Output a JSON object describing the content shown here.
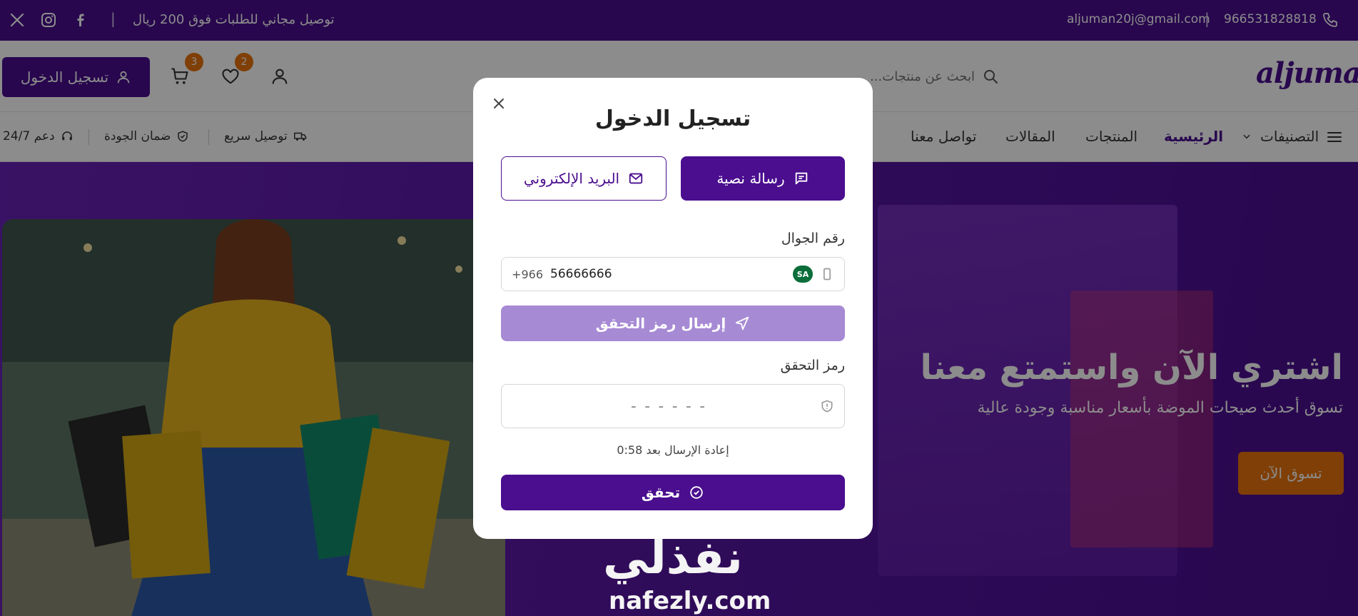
{
  "topbar": {
    "promo": "توصيل مجاني للطلبات فوق 200 ريال",
    "email": "aljuman20j@gmail.com",
    "phone": "966531828818",
    "separator": "|"
  },
  "header": {
    "logo": "aljuman",
    "search_placeholder": "ابحث عن منتجات...",
    "login_label": "تسجيل الدخول",
    "wishlist_count": "2",
    "cart_count": "3"
  },
  "nav": {
    "categories": "التصنيفات",
    "home": "الرئيسية",
    "products": "المنتجات",
    "articles": "المقالات",
    "contact": "تواصل معنا",
    "features": {
      "fast_delivery": "توصيل سريع",
      "quality": "ضمان الجودة",
      "support": "دعم 24/7"
    }
  },
  "hero": {
    "title": "اشتري الآن واستمتع معنا",
    "subtitle": "تسوق أحدث صيحات الموضة بأسعار مناسبة وجودة عالية",
    "cta": "تسوق الآن"
  },
  "modal": {
    "title": "تسجيل الدخول",
    "tab_sms": "رسالة نصية",
    "tab_email": "البريد الإلكتروني",
    "phone_label": "رقم الجوال",
    "country_badge": "SA",
    "phone_value": "56666666",
    "country_code": "+966",
    "send_code": "إرسال رمز التحقق",
    "code_label": "رمز التحقق",
    "code_placeholder": "------",
    "resend_text": "إعادة الإرسال بعد 0:58",
    "verify": "تحقق"
  },
  "watermark": {
    "arabic": "نفذلي",
    "url": "nafezly.com"
  },
  "colors": {
    "primary": "#4a0e8f",
    "accent": "#e8740c",
    "disabled": "#a78ad4"
  }
}
